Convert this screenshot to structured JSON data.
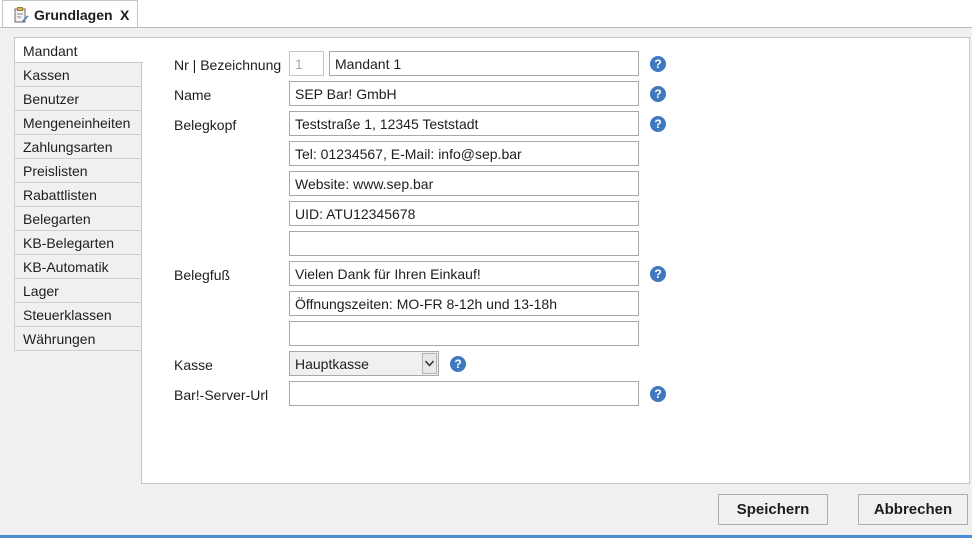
{
  "document_tab": {
    "title": "Grundlagen",
    "close_label": "X",
    "icon": "clipboard-edit-icon"
  },
  "sidebar": {
    "items": [
      {
        "label": "Mandant",
        "active": true
      },
      {
        "label": "Kassen"
      },
      {
        "label": "Benutzer"
      },
      {
        "label": "Mengeneinheiten"
      },
      {
        "label": "Zahlungsarten"
      },
      {
        "label": "Preislisten"
      },
      {
        "label": "Rabattlisten"
      },
      {
        "label": "Belegarten"
      },
      {
        "label": "KB-Belegarten"
      },
      {
        "label": "KB-Automatik"
      },
      {
        "label": "Lager"
      },
      {
        "label": "Steuerklassen"
      },
      {
        "label": "Währungen"
      }
    ]
  },
  "form": {
    "nr_label": "Nr | Bezeichnung",
    "nr_value": "1",
    "bezeichnung_value": "Mandant 1",
    "name_label": "Name",
    "name_value": "SEP Bar! GmbH",
    "belegkopf_label": "Belegkopf",
    "belegkopf_lines": [
      "Teststraße 1, 12345 Teststadt",
      "Tel: 01234567, E-Mail: info@sep.bar",
      "Website: www.sep.bar",
      "UID: ATU12345678",
      ""
    ],
    "belegfuss_label": "Belegfuß",
    "belegfuss_lines": [
      "Vielen Dank für Ihren Einkauf!",
      "Öffnungszeiten: MO-FR 8-12h und 13-18h",
      ""
    ],
    "kasse_label": "Kasse",
    "kasse_value": "Hauptkasse",
    "server_url_label": "Bar!-Server-Url",
    "server_url_value": "",
    "help_glyph": "?"
  },
  "buttons": {
    "save_label": "Speichern",
    "cancel_label": "Abbrechen"
  },
  "colors": {
    "help_icon": "#3e79bf",
    "accent_line": "#4a8fd6"
  }
}
